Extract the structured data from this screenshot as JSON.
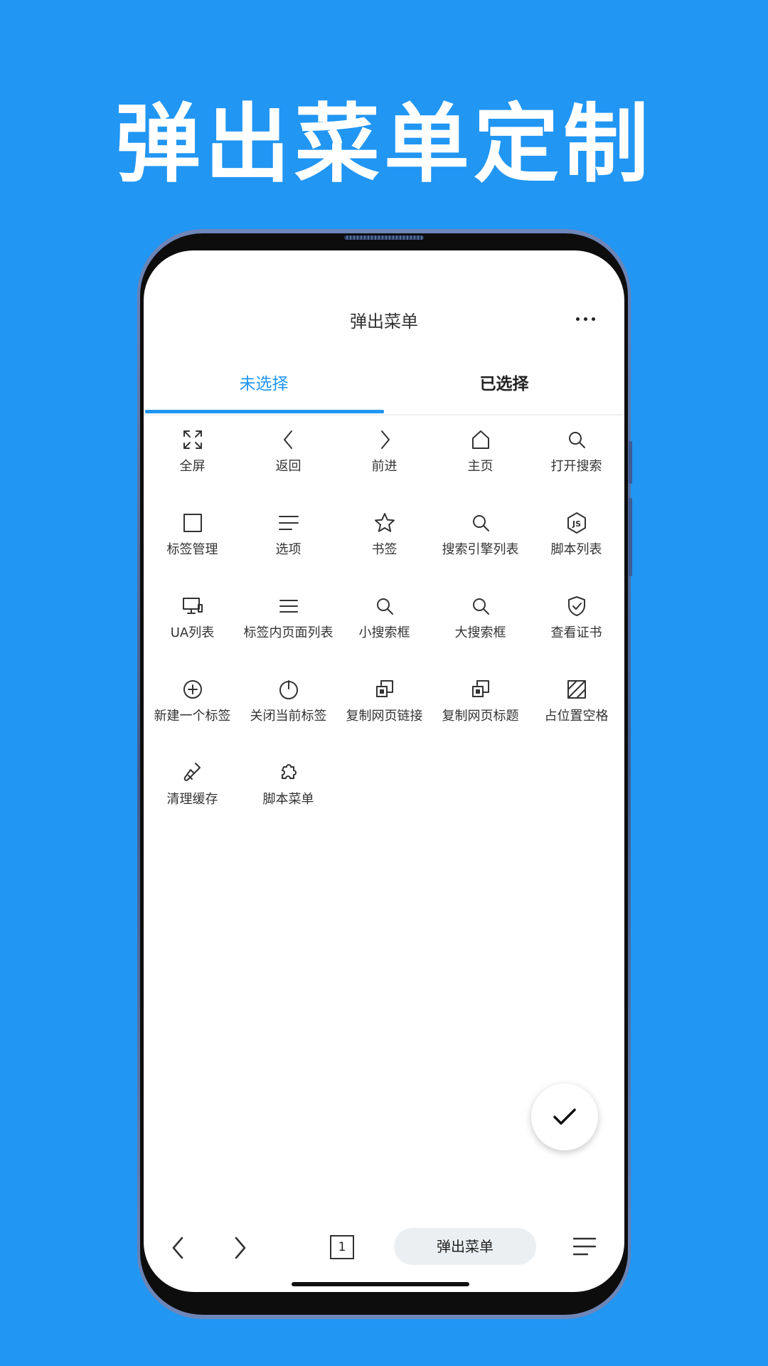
{
  "headline": "弹出菜单定制",
  "titlebar": {
    "title": "弹出菜单"
  },
  "tabs": [
    {
      "label": "未选择",
      "active": true
    },
    {
      "label": "已选择",
      "active": false
    }
  ],
  "items": [
    {
      "label": "全屏",
      "icon": "fullscreen-icon"
    },
    {
      "label": "返回",
      "icon": "chevron-left-icon"
    },
    {
      "label": "前进",
      "icon": "chevron-right-icon"
    },
    {
      "label": "主页",
      "icon": "home-icon"
    },
    {
      "label": "打开搜索",
      "icon": "search-icon"
    },
    {
      "label": "标签管理",
      "icon": "square-icon"
    },
    {
      "label": "选项",
      "icon": "lines-icon"
    },
    {
      "label": "书签",
      "icon": "star-icon"
    },
    {
      "label": "搜索引擎列表",
      "icon": "search-icon"
    },
    {
      "label": "脚本列表",
      "icon": "js-icon"
    },
    {
      "label": "UA列表",
      "icon": "monitor-icon"
    },
    {
      "label": "标签内页面列表",
      "icon": "menu-icon"
    },
    {
      "label": "小搜索框",
      "icon": "search-icon"
    },
    {
      "label": "大搜索框",
      "icon": "search-icon"
    },
    {
      "label": "查看证书",
      "icon": "shield-check-icon"
    },
    {
      "label": "新建一个标签",
      "icon": "plus-circle-icon"
    },
    {
      "label": "关闭当前标签",
      "icon": "power-icon"
    },
    {
      "label": "复制网页链接",
      "icon": "copy-icon"
    },
    {
      "label": "复制网页标题",
      "icon": "copy-icon"
    },
    {
      "label": "占位置空格",
      "icon": "hatched-square-icon"
    },
    {
      "label": "清理缓存",
      "icon": "broom-icon"
    },
    {
      "label": "脚本菜单",
      "icon": "puzzle-icon"
    }
  ],
  "fab": {
    "icon": "check-icon"
  },
  "bottomnav": {
    "back_icon": "chevron-left-icon",
    "forward_icon": "chevron-right-icon",
    "tabs_count": "1",
    "menu_label": "弹出菜单",
    "more_icon": "menu-lines-icon"
  },
  "colors": {
    "accent": "#2196F3",
    "background": "#2196F3"
  }
}
